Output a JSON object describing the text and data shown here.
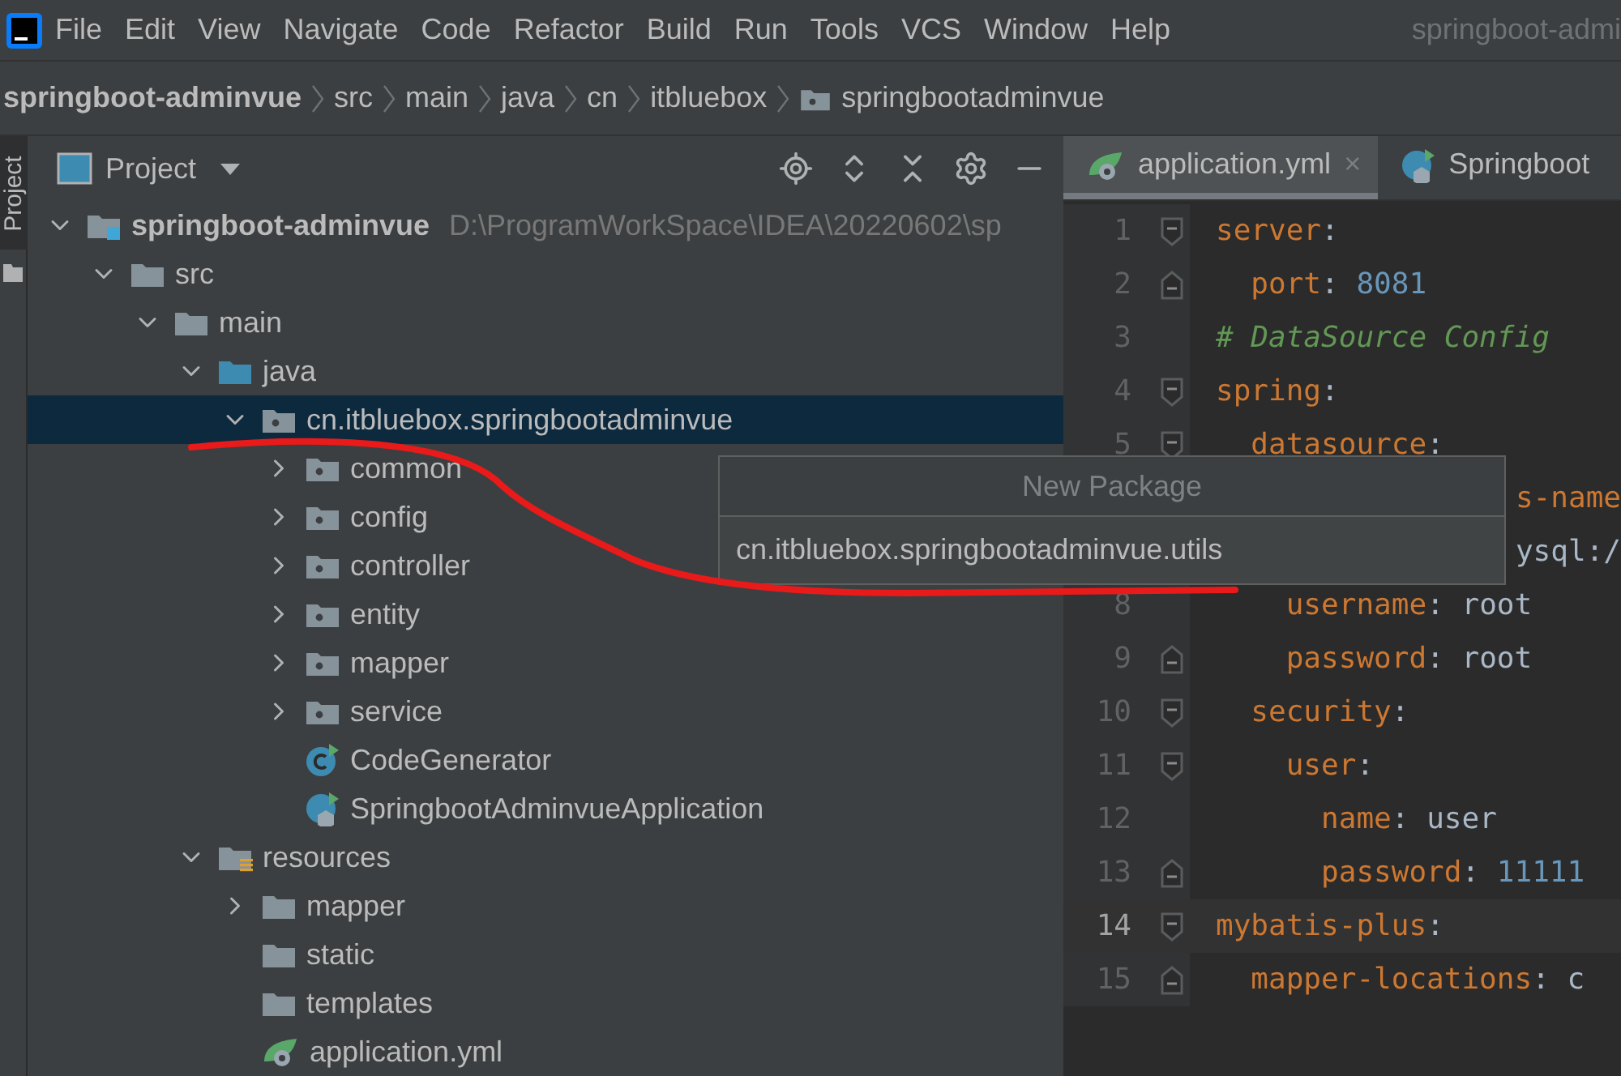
{
  "menu_bar": {
    "items": [
      "File",
      "Edit",
      "View",
      "Navigate",
      "Code",
      "Refactor",
      "Build",
      "Run",
      "Tools",
      "VCS",
      "Window",
      "Help"
    ],
    "title": "springboot-admi"
  },
  "breadcrumb": [
    {
      "label": "springboot-adminvue",
      "kind": "project"
    },
    {
      "label": "src",
      "kind": "dir"
    },
    {
      "label": "main",
      "kind": "dir"
    },
    {
      "label": "java",
      "kind": "dir"
    },
    {
      "label": "cn",
      "kind": "dir"
    },
    {
      "label": "itbluebox",
      "kind": "dir"
    },
    {
      "label": "springbootadminvue",
      "kind": "package"
    }
  ],
  "side_stripe": {
    "label": "Project"
  },
  "project_panel": {
    "title": "Project",
    "tree": [
      {
        "label": "springboot-adminvue",
        "path": "D:\\ProgramWorkSpace\\IDEA\\20220602\\sp",
        "kind": "module",
        "expanded": true,
        "selected": false,
        "children": [
          {
            "label": "src",
            "kind": "folder",
            "expanded": true,
            "selected": false,
            "children": [
              {
                "label": "main",
                "kind": "folder",
                "expanded": true,
                "selected": false,
                "children": [
                  {
                    "label": "java",
                    "kind": "source",
                    "expanded": true,
                    "selected": false,
                    "children": [
                      {
                        "label": "cn.itbluebox.springbootadminvue",
                        "kind": "package",
                        "expanded": true,
                        "selected": true,
                        "children": [
                          {
                            "label": "common",
                            "kind": "package",
                            "expanded": false,
                            "selected": false
                          },
                          {
                            "label": "config",
                            "kind": "package",
                            "expanded": false,
                            "selected": false
                          },
                          {
                            "label": "controller",
                            "kind": "package",
                            "expanded": false,
                            "selected": false
                          },
                          {
                            "label": "entity",
                            "kind": "package",
                            "expanded": false,
                            "selected": false
                          },
                          {
                            "label": "mapper",
                            "kind": "package",
                            "expanded": false,
                            "selected": false
                          },
                          {
                            "label": "service",
                            "kind": "package",
                            "expanded": false,
                            "selected": false
                          },
                          {
                            "label": "CodeGenerator",
                            "kind": "class",
                            "selected": false
                          },
                          {
                            "label": "SpringbootAdminvueApplication",
                            "kind": "app",
                            "selected": false
                          }
                        ]
                      }
                    ]
                  },
                  {
                    "label": "resources",
                    "kind": "resources",
                    "expanded": true,
                    "selected": false,
                    "children": [
                      {
                        "label": "mapper",
                        "kind": "folder",
                        "expanded": false,
                        "selected": false
                      },
                      {
                        "label": "static",
                        "kind": "folder",
                        "selected": false
                      },
                      {
                        "label": "templates",
                        "kind": "folder",
                        "selected": false
                      },
                      {
                        "label": "application.yml",
                        "kind": "yml",
                        "selected": false
                      }
                    ]
                  }
                ]
              }
            ]
          }
        ]
      }
    ]
  },
  "editor": {
    "tabs": [
      {
        "label": "application.yml",
        "kind": "yml",
        "selected": true,
        "close": "×"
      },
      {
        "label": "Springboot",
        "kind": "app",
        "selected": false
      }
    ],
    "lines": [
      {
        "number": "1",
        "fold_start": true,
        "current": false,
        "segments": [
          {
            "kind": "key",
            "text": "server"
          },
          {
            "kind": "punct",
            "text": ":"
          }
        ]
      },
      {
        "number": "2",
        "fold_end": true,
        "current": false,
        "segments": [
          {
            "kind": "key",
            "text": "  port"
          },
          {
            "kind": "punct",
            "text": ": "
          },
          {
            "kind": "number",
            "text": "8081"
          }
        ]
      },
      {
        "number": "3",
        "current": false,
        "segments": [
          {
            "kind": "comment",
            "text": "# DataSource Config"
          }
        ]
      },
      {
        "number": "4",
        "fold_start": true,
        "current": false,
        "segments": [
          {
            "kind": "key",
            "text": "spring"
          },
          {
            "kind": "punct",
            "text": ":"
          }
        ]
      },
      {
        "number": "5",
        "fold_start": true,
        "current": false,
        "segments": [
          {
            "kind": "key",
            "text": "  datasource"
          },
          {
            "kind": "punct",
            "text": ":"
          }
        ]
      },
      {
        "covered": true,
        "current": false,
        "segments": [
          {
            "kind": "key",
            "text": "s-name"
          }
        ]
      },
      {
        "covered": true,
        "current": false,
        "segments": [
          {
            "kind": "plain",
            "text": "ysql:/"
          }
        ]
      },
      {
        "number": "8",
        "current": false,
        "segments": [
          {
            "kind": "key",
            "text": "    username"
          },
          {
            "kind": "punct",
            "text": ": "
          },
          {
            "kind": "plain",
            "text": "root"
          }
        ]
      },
      {
        "number": "9",
        "fold_end": true,
        "current": false,
        "segments": [
          {
            "kind": "key",
            "text": "    password"
          },
          {
            "kind": "punct",
            "text": ": "
          },
          {
            "kind": "plain",
            "text": "root"
          }
        ]
      },
      {
        "number": "10",
        "fold_start": true,
        "current": false,
        "segments": [
          {
            "kind": "key",
            "text": "  security"
          },
          {
            "kind": "punct",
            "text": ":"
          }
        ]
      },
      {
        "number": "11",
        "fold_start": true,
        "current": false,
        "segments": [
          {
            "kind": "key",
            "text": "    user"
          },
          {
            "kind": "punct",
            "text": ":"
          }
        ]
      },
      {
        "number": "12",
        "current": false,
        "segments": [
          {
            "kind": "key",
            "text": "      name"
          },
          {
            "kind": "punct",
            "text": ": "
          },
          {
            "kind": "plain",
            "text": "user"
          }
        ]
      },
      {
        "number": "13",
        "fold_end": true,
        "current": false,
        "segments": [
          {
            "kind": "key",
            "text": "      password"
          },
          {
            "kind": "punct",
            "text": ": "
          },
          {
            "kind": "number",
            "text": "11111"
          }
        ]
      },
      {
        "number": "14",
        "fold_start": true,
        "current": true,
        "segments": [
          {
            "kind": "key",
            "text": "mybatis-plus"
          },
          {
            "kind": "punct",
            "text": ":"
          }
        ]
      },
      {
        "number": "15",
        "fold_end": true,
        "current": false,
        "segments": [
          {
            "kind": "key",
            "text": "  mapper-locations"
          },
          {
            "kind": "punct",
            "text": ": "
          },
          {
            "kind": "plain",
            "text": "c"
          }
        ]
      }
    ]
  },
  "popup": {
    "title": "New Package",
    "value": "cn.itbluebox.springbootadminvue.utils"
  }
}
